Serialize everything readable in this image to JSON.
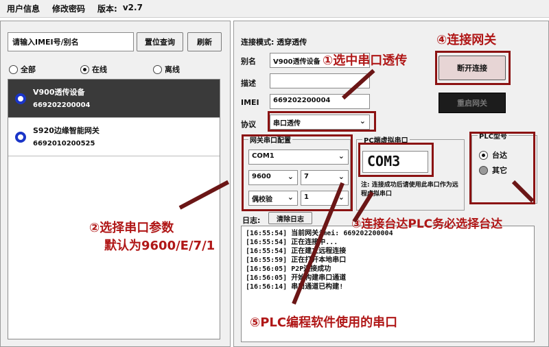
{
  "menu": {
    "user_info": "用户信息",
    "change_password": "修改密码",
    "version_label": "版本:",
    "version_value": "v2.7"
  },
  "left": {
    "search_placeholder": "请输入IMEI号/别名",
    "reset_query_label": "置位查询",
    "refresh_label": "刷新",
    "filters": [
      {
        "label": "全部",
        "checked": false
      },
      {
        "label": "在线",
        "checked": true
      },
      {
        "label": "离线",
        "checked": false
      }
    ],
    "devices": [
      {
        "name": "V900透传设备",
        "imei": "669202200004",
        "selected": true
      },
      {
        "name": "S920边缘智能网关",
        "imei": "6692010200525",
        "selected": false
      }
    ]
  },
  "right": {
    "mode_label": "连接模式: 透穿透传",
    "alias_label": "别名",
    "alias_value": "V900透传设备",
    "desc_label": "描述",
    "desc_value": "",
    "imei_label": "IMEI",
    "imei_value": "669202200004",
    "protocol_label": "协议",
    "protocol_value": "串口透传",
    "disconnect_label": "断开连接",
    "gateway_btn_label": "重启网关",
    "serial_group_title": "网关串口配置",
    "serial_port": "COM1",
    "baud": "9600",
    "data_bits": "7",
    "parity": "偶校验",
    "stop_bits": "1",
    "vcom_group_title": "PC端虚拟串口",
    "vcom_value": "COM3",
    "vcom_note": "注: 连接成功后请使用此串口作为远程虚拟串口",
    "plc_group_title": "PLC型号",
    "plc_options": [
      {
        "label": "台达",
        "checked": true
      },
      {
        "label": "其它",
        "checked": false
      }
    ],
    "log_label": "日志:",
    "clear_log_label": "清除日志",
    "log_lines": [
      "[16:55:54] 当前网关imei: 669202200004",
      "[16:55:54] 正在连接中...",
      "[16:55:54] 正在建立远程连接",
      "[16:55:59] 正在打开本地串口",
      "[16:56:05] P2P连接成功",
      "[16:56:05] 开始构建串口通道",
      "[16:56:14] 串口通道已构建!"
    ]
  },
  "annotations": {
    "a1": "①选中串口透传",
    "a2": "②选择串口参数",
    "a2b": "默认为9600/E/7/1",
    "a3": "③连接台达PLC务必选择台达",
    "a4": "④连接网关",
    "a5": "⑤PLC编程软件使用的串口"
  },
  "colors": {
    "annotation": "#b01717",
    "selected_row": "#3a3a3a",
    "device_dot": "#1a35c8"
  }
}
